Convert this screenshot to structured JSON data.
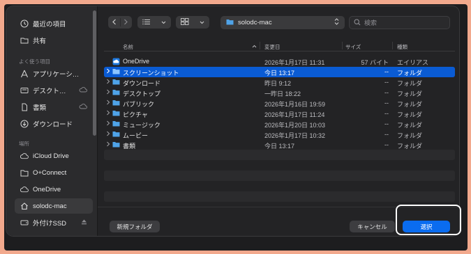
{
  "sidebar": {
    "recents_label": "最近の項目",
    "shared_label": "共有",
    "favorites_header": "よく使う項目",
    "favorites": [
      {
        "label": "アプリケーシ…",
        "icon": "applications-icon"
      },
      {
        "label": "デスクト…",
        "icon": "desktop-icon"
      },
      {
        "label": "書類",
        "icon": "document-icon"
      },
      {
        "label": "ダウンロード",
        "icon": "download-icon"
      }
    ],
    "locations_header": "場所",
    "locations": [
      {
        "label": "iCloud Drive",
        "icon": "cloud-icon"
      },
      {
        "label": "O+Connect",
        "icon": "folder-icon"
      },
      {
        "label": "OneDrive",
        "icon": "cloud-icon"
      },
      {
        "label": "solodc-mac",
        "icon": "home-icon"
      },
      {
        "label": "外付けSSD",
        "icon": "external-drive-icon"
      }
    ]
  },
  "toolbar": {
    "path": "solodc-mac",
    "search_placeholder": "検索"
  },
  "columns": {
    "name": "名前",
    "modified": "変更日",
    "size": "サイズ",
    "kind": "種類"
  },
  "files": [
    {
      "name": "OneDrive",
      "date": "2026年1月17日 11:31",
      "size": "57 バイト",
      "kind": "エイリアス",
      "type": "alias"
    },
    {
      "name": "スクリーンショット",
      "date": "今日 13:17",
      "size": "--",
      "kind": "フォルダ",
      "type": "folder"
    },
    {
      "name": "ダウンロード",
      "date": "昨日 9:12",
      "size": "--",
      "kind": "フォルダ",
      "type": "folder"
    },
    {
      "name": "デスクトップ",
      "date": "一昨日 18:22",
      "size": "--",
      "kind": "フォルダ",
      "type": "folder"
    },
    {
      "name": "パブリック",
      "date": "2026年1月16日 19:59",
      "size": "--",
      "kind": "フォルダ",
      "type": "folder"
    },
    {
      "name": "ピクチャ",
      "date": "2026年1月17日 11:24",
      "size": "--",
      "kind": "フォルダ",
      "type": "folder"
    },
    {
      "name": "ミュージック",
      "date": "2026年1月20日 10:03",
      "size": "--",
      "kind": "フォルダ",
      "type": "folder"
    },
    {
      "name": "ムービー",
      "date": "2026年1月17日 10:32",
      "size": "--",
      "kind": "フォルダ",
      "type": "folder"
    },
    {
      "name": "書類",
      "date": "今日 13:17",
      "size": "--",
      "kind": "フォルダ",
      "type": "folder"
    }
  ],
  "buttons": {
    "new_folder": "新規フォルダ",
    "cancel": "キャンセル",
    "choose": "選択"
  },
  "colors": {
    "accent": "#0a6cf0",
    "selection": "#0a5bd3",
    "folder": "#4fa3e8"
  }
}
